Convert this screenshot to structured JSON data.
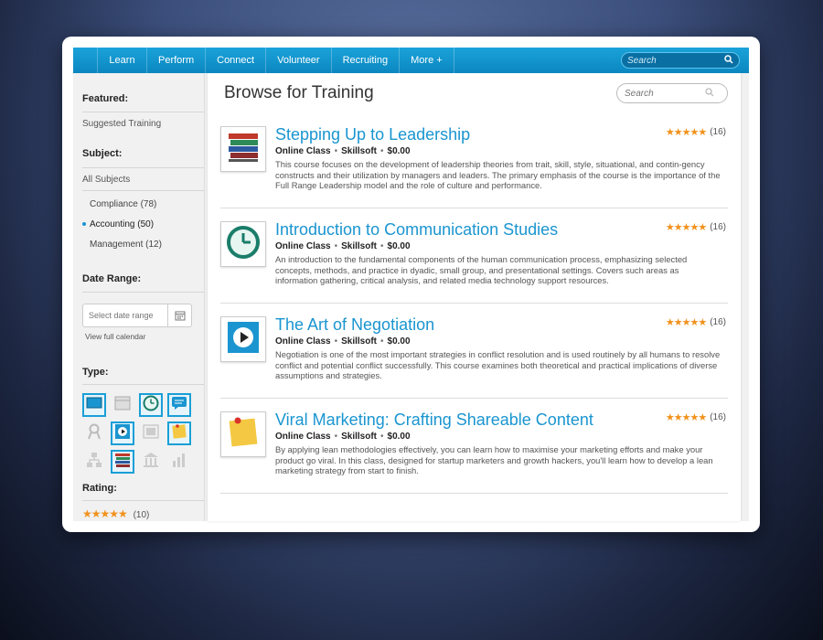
{
  "nav": {
    "items": [
      "Learn",
      "Perform",
      "Connect",
      "Volunteer",
      "Recruiting",
      "More +"
    ],
    "search_placeholder": "Search"
  },
  "sidebar": {
    "featured_heading": "Featured:",
    "featured_link": "Suggested Training",
    "subject_heading": "Subject:",
    "all_subjects": "All Subjects",
    "subjects": [
      {
        "label": "Compliance (78)"
      },
      {
        "label": "Accounting (50)"
      },
      {
        "label": "Management (12)"
      }
    ],
    "date_heading": "Date Range:",
    "date_placeholder": "Select date range",
    "view_calendar": "View full calendar",
    "type_heading": "Type:",
    "rating_heading": "Rating:",
    "rating_stars": "★★★★★",
    "rating_count": "(10)"
  },
  "main": {
    "title": "Browse for Training",
    "search_placeholder": "Search",
    "courses": [
      {
        "title": "Stepping Up to Leadership",
        "type": "Online Class",
        "provider": "Skillsoft",
        "price": "$0.00",
        "stars": "★★★★★",
        "count": "(16)",
        "desc": "This course focuses on the development of leadership theories from trait, skill, style, situational, and contin-gency constructs and their utilization by managers and leaders. The primary emphasis of the course is the importance of the Full Range Leadership model and the role of culture and performance."
      },
      {
        "title": "Introduction to Communication Studies",
        "type": "Online Class",
        "provider": "Skillsoft",
        "price": "$0.00",
        "stars": "★★★★★",
        "count": "(16)",
        "desc": "An introduction to the fundamental components of the human communication process, emphasizing selected concepts, methods, and practice in dyadic, small group, and presentational settings. Covers such areas as information gathering, critical analysis, and related media technology support resources."
      },
      {
        "title": "The Art of Negotiation",
        "type": "Online Class",
        "provider": "Skillsoft",
        "price": "$0.00",
        "stars": "★★★★★",
        "count": "(16)",
        "desc": "Negotiation is one of the most important strategies in conflict resolution and is used routinely by all humans to resolve conflict and potential conflict successfully. This course examines both theoretical and practical implications of diverse assumptions and strategies."
      },
      {
        "title": "Viral Marketing: Crafting Shareable Content",
        "type": "Online Class",
        "provider": "Skillsoft",
        "price": "$0.00",
        "stars": "★★★★★",
        "count": "(16)",
        "desc": "By applying lean methodologies effectively, you can learn how to maximise your marketing efforts and make your product go viral. In this class, designed for startup marketers and growth hackers, you'll learn how to develop a lean marketing strategy from start to finish."
      }
    ]
  },
  "colors": {
    "accent": "#1a95d0",
    "nav": "#0b87c0",
    "star": "#f0921c"
  }
}
